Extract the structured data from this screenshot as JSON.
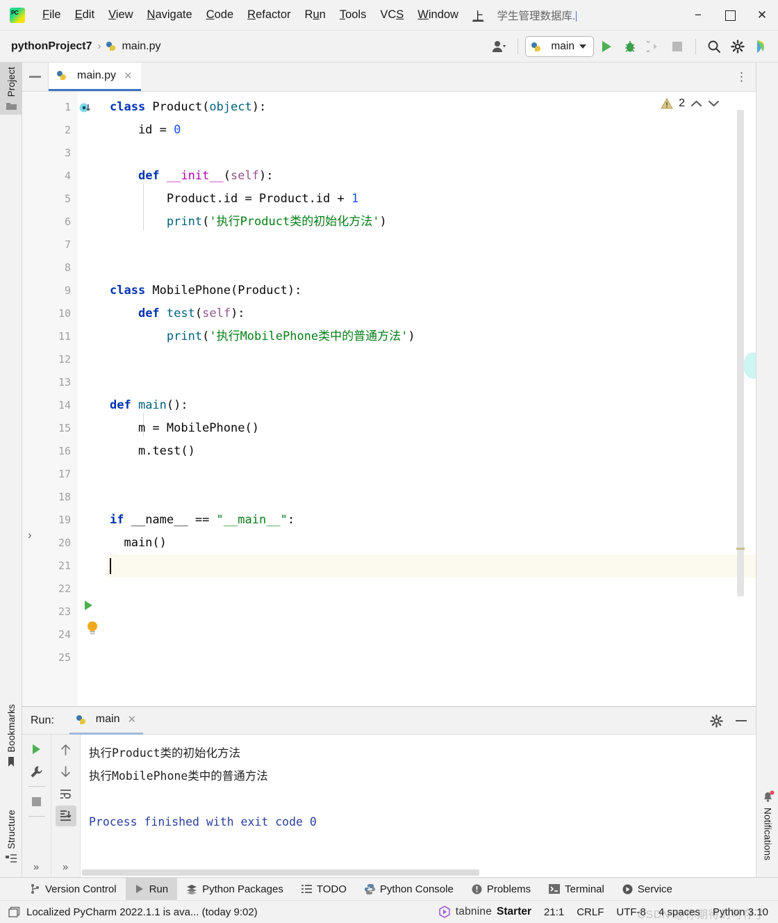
{
  "titlebar": {
    "app_icon": "pycharm-logo-icon",
    "menus": [
      {
        "label": "File",
        "mnemonic": "F"
      },
      {
        "label": "Edit",
        "mnemonic": "E"
      },
      {
        "label": "View",
        "mnemonic": "V"
      },
      {
        "label": "Navigate",
        "mnemonic": "N"
      },
      {
        "label": "Code",
        "mnemonic": "C"
      },
      {
        "label": "Refactor",
        "mnemonic": "R"
      },
      {
        "label": "Run",
        "mnemonic": "u"
      },
      {
        "label": "Tools",
        "mnemonic": "T"
      },
      {
        "label": "VCS",
        "mnemonic": "S"
      },
      {
        "label": "Window",
        "mnemonic": "W"
      },
      {
        "label": "上",
        "mnemonic": "上"
      }
    ],
    "window_title": "学生管理数据库.",
    "minimize": "−",
    "maximize": "☐",
    "close": "✕"
  },
  "toolbar": {
    "project_name": "pythonProject7",
    "separator": "›",
    "file_name": "main.py",
    "run_config": "main",
    "icons": [
      "user-avatar-icon",
      "run-icon",
      "debug-icon",
      "run-coverage-icon",
      "stop-icon",
      "search-icon",
      "settings-gear-icon",
      "ide-assistant-icon"
    ]
  },
  "left_rail": {
    "top_tabs": [
      {
        "label": "Project",
        "icon": "folder-icon",
        "active": true
      }
    ],
    "bottom_tabs": [
      {
        "label": "Bookmarks",
        "icon": "bookmark-icon",
        "active": false
      },
      {
        "label": "Structure",
        "icon": "structure-icon",
        "active": false
      }
    ]
  },
  "right_rail": {
    "tabs": [
      {
        "label": "Notifications",
        "icon": "bell-icon",
        "badge": true
      }
    ]
  },
  "editor": {
    "tab": {
      "label": "main.py",
      "icon": "python-file-icon",
      "close": "✕"
    },
    "more_actions": "⋮",
    "inspection": {
      "icon": "warning-triangle-icon",
      "count": "2",
      "prev": "˄",
      "next": "˅"
    },
    "cursor_line": 21,
    "lines": [
      {
        "n": 1,
        "tokens": [
          {
            "t": "class ",
            "c": "kw"
          },
          {
            "t": "Product",
            "c": "pln"
          },
          {
            "t": "(",
            "c": "pln"
          },
          {
            "t": "object",
            "c": "fn"
          },
          {
            "t": "):",
            "c": "pln"
          }
        ]
      },
      {
        "n": 2,
        "tokens": [
          {
            "t": "    id = ",
            "c": "pln"
          },
          {
            "t": "0",
            "c": "num"
          }
        ]
      },
      {
        "n": 3,
        "tokens": []
      },
      {
        "n": 4,
        "tokens": [
          {
            "t": "    ",
            "c": "pln"
          },
          {
            "t": "def ",
            "c": "kw"
          },
          {
            "t": "__init__",
            "c": "dunder"
          },
          {
            "t": "(",
            "c": "pln"
          },
          {
            "t": "self",
            "c": "self"
          },
          {
            "t": "):",
            "c": "pln"
          }
        ]
      },
      {
        "n": 5,
        "tokens": [
          {
            "t": "        Product.id = Product.id + ",
            "c": "pln"
          },
          {
            "t": "1",
            "c": "num"
          }
        ]
      },
      {
        "n": 6,
        "tokens": [
          {
            "t": "        ",
            "c": "pln"
          },
          {
            "t": "print",
            "c": "fn"
          },
          {
            "t": "(",
            "c": "pln"
          },
          {
            "t": "'执行Product类的初始化方法'",
            "c": "str"
          },
          {
            "t": ")",
            "c": "pln"
          }
        ]
      },
      {
        "n": 7,
        "tokens": []
      },
      {
        "n": 8,
        "tokens": []
      },
      {
        "n": 9,
        "tokens": [
          {
            "t": "class ",
            "c": "kw"
          },
          {
            "t": "MobilePhone",
            "c": "pln"
          },
          {
            "t": "(",
            "c": "pln"
          },
          {
            "t": "Product",
            "c": "pln"
          },
          {
            "t": "):",
            "c": "pln"
          }
        ]
      },
      {
        "n": 10,
        "tokens": [
          {
            "t": "    ",
            "c": "pln"
          },
          {
            "t": "def ",
            "c": "kw"
          },
          {
            "t": "test",
            "c": "fn"
          },
          {
            "t": "(",
            "c": "pln"
          },
          {
            "t": "self",
            "c": "self"
          },
          {
            "t": "):",
            "c": "pln"
          }
        ]
      },
      {
        "n": 11,
        "tokens": [
          {
            "t": "        ",
            "c": "pln"
          },
          {
            "t": "print",
            "c": "fn"
          },
          {
            "t": "(",
            "c": "pln"
          },
          {
            "t": "'执行MobilePhone类中的普通方法'",
            "c": "str"
          },
          {
            "t": ")",
            "c": "pln"
          }
        ]
      },
      {
        "n": 12,
        "tokens": []
      },
      {
        "n": 13,
        "tokens": []
      },
      {
        "n": 14,
        "tokens": [
          {
            "t": "def ",
            "c": "kw"
          },
          {
            "t": "main",
            "c": "fn"
          },
          {
            "t": "():",
            "c": "pln"
          }
        ]
      },
      {
        "n": 15,
        "tokens": [
          {
            "t": "    m = MobilePhone()",
            "c": "pln"
          }
        ]
      },
      {
        "n": 16,
        "tokens": [
          {
            "t": "    m.test()",
            "c": "pln"
          }
        ]
      },
      {
        "n": 17,
        "tokens": []
      },
      {
        "n": 18,
        "tokens": []
      },
      {
        "n": 19,
        "tokens": [
          {
            "t": "if ",
            "c": "kw"
          },
          {
            "t": "__name__ == ",
            "c": "pln"
          },
          {
            "t": "\"__main__\"",
            "c": "str"
          },
          {
            "t": ":",
            "c": "pln"
          }
        ]
      },
      {
        "n": 20,
        "tokens": [
          {
            "t": "  main()",
            "c": "pln"
          }
        ]
      },
      {
        "n": 21,
        "tokens": []
      },
      {
        "n": 22,
        "tokens": []
      },
      {
        "n": 23,
        "tokens": []
      },
      {
        "n": 24,
        "tokens": []
      },
      {
        "n": 25,
        "tokens": []
      }
    ]
  },
  "run_panel": {
    "title": "Run:",
    "tab": {
      "label": "main",
      "icon": "python-icon",
      "close": "✕"
    },
    "header_icons": [
      "settings-gear-icon",
      "hide-icon"
    ],
    "left_tools": [
      "rerun-icon",
      "wrench-icon",
      "stop-icon",
      "more-icon"
    ],
    "right_tools": [
      "up-arrow-icon",
      "down-arrow-icon",
      "soft-wrap-icon",
      "scroll-to-end-icon",
      "more-icon"
    ],
    "console_lines": [
      {
        "text": "执行Product类的初始化方法",
        "kind": "out"
      },
      {
        "text": "执行MobilePhone类中的普通方法",
        "kind": "out"
      },
      {
        "text": "",
        "kind": "out"
      },
      {
        "text": "Process finished with exit code 0",
        "kind": "exit"
      }
    ]
  },
  "toolwindow_bar": [
    {
      "label": "Version Control",
      "icon": "branch-icon",
      "active": false
    },
    {
      "label": "Run",
      "icon": "run-icon",
      "active": true
    },
    {
      "label": "Python Packages",
      "icon": "packages-icon",
      "active": false
    },
    {
      "label": "TODO",
      "icon": "todo-list-icon",
      "active": false
    },
    {
      "label": "Python Console",
      "icon": "python-icon",
      "active": false
    },
    {
      "label": "Problems",
      "icon": "problems-icon",
      "active": false
    },
    {
      "label": "Terminal",
      "icon": "terminal-icon",
      "active": false
    },
    {
      "label": "Service",
      "icon": "services-icon",
      "active": false
    }
  ],
  "statusbar": {
    "notification_icon": "ide-update-icon",
    "notification": "Localized PyCharm 2022.1.1 is ava... (today 9:02)",
    "tabnine": {
      "icon": "tabnine-logo-icon",
      "name": "tabnine",
      "plan": "Starter"
    },
    "caret": "21:1",
    "line_sep": "CRLF",
    "encoding": "UTF-8",
    "indent": "4 spaces",
    "interpreter": "Python 3.10",
    "watermark": "CSDN @你期待的可存了"
  },
  "colors": {
    "accent": "#3b78c3",
    "run_green": "#4caf50",
    "keyword": "#0033b3",
    "string": "#067d17",
    "number": "#1750eb",
    "function": "#00627a",
    "self": "#94558d",
    "dunder": "#b200b2",
    "exit_text": "#2b3ea0"
  }
}
